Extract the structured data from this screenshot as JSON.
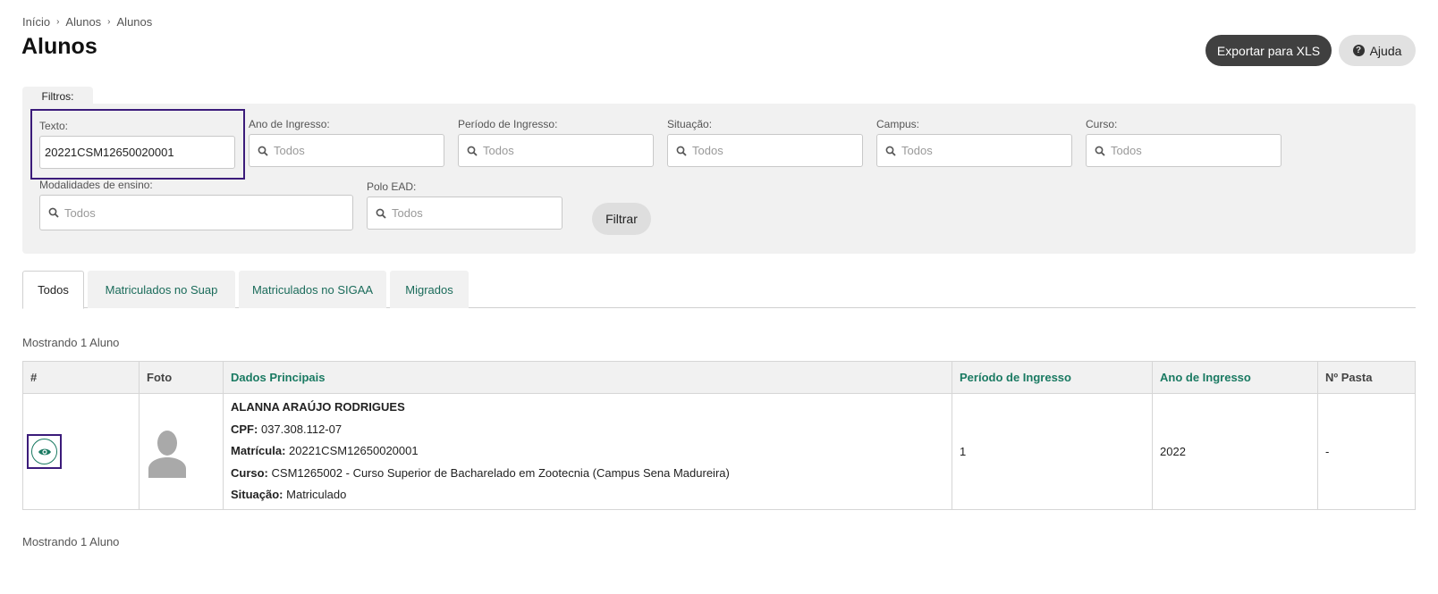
{
  "breadcrumb": [
    "Início",
    "Alunos",
    "Alunos"
  ],
  "page_title": "Alunos",
  "actions": {
    "export_label": "Exportar para XLS",
    "help_label": "Ajuda"
  },
  "filters": {
    "tab_label": "Filtros:",
    "texto": {
      "label": "Texto:",
      "value": "20221CSM12650020001"
    },
    "ano_ingresso": {
      "label": "Ano de Ingresso:",
      "placeholder": "Todos"
    },
    "periodo_ingresso": {
      "label": "Período de Ingresso:",
      "placeholder": "Todos"
    },
    "situacao": {
      "label": "Situação:",
      "placeholder": "Todos"
    },
    "campus": {
      "label": "Campus:",
      "placeholder": "Todos"
    },
    "curso": {
      "label": "Curso:",
      "placeholder": "Todos"
    },
    "modalidades": {
      "label": "Modalidades de ensino:",
      "placeholder": "Todos"
    },
    "polo_ead": {
      "label": "Polo EAD:",
      "placeholder": "Todos"
    },
    "filter_button": "Filtrar"
  },
  "tabs": [
    "Todos",
    "Matriculados no Suap",
    "Matriculados no SIGAA",
    "Migrados"
  ],
  "active_tab": "Todos",
  "result_count": "Mostrando 1 Aluno",
  "table": {
    "headers": [
      "#",
      "Foto",
      "Dados Principais",
      "Período de Ingresso",
      "Ano de Ingresso",
      "Nº Pasta"
    ],
    "rows": [
      {
        "nome": "ALANNA ARAÚJO RODRIGUES",
        "cpf_label": "CPF:",
        "cpf": "037.308.112-07",
        "matricula_label": "Matrícula:",
        "matricula": "20221CSM12650020001",
        "curso_label": "Curso:",
        "curso": "CSM1265002 - Curso Superior de Bacharelado em Zootecnia (Campus Sena Madureira)",
        "situacao_label": "Situação:",
        "situacao": "Matriculado",
        "periodo_ingresso": "1",
        "ano_ingresso": "2022",
        "pasta": "-"
      }
    ]
  },
  "colors": {
    "accent": "#1a7a62",
    "highlight": "#3b1b7a",
    "dark_button": "#404040"
  }
}
